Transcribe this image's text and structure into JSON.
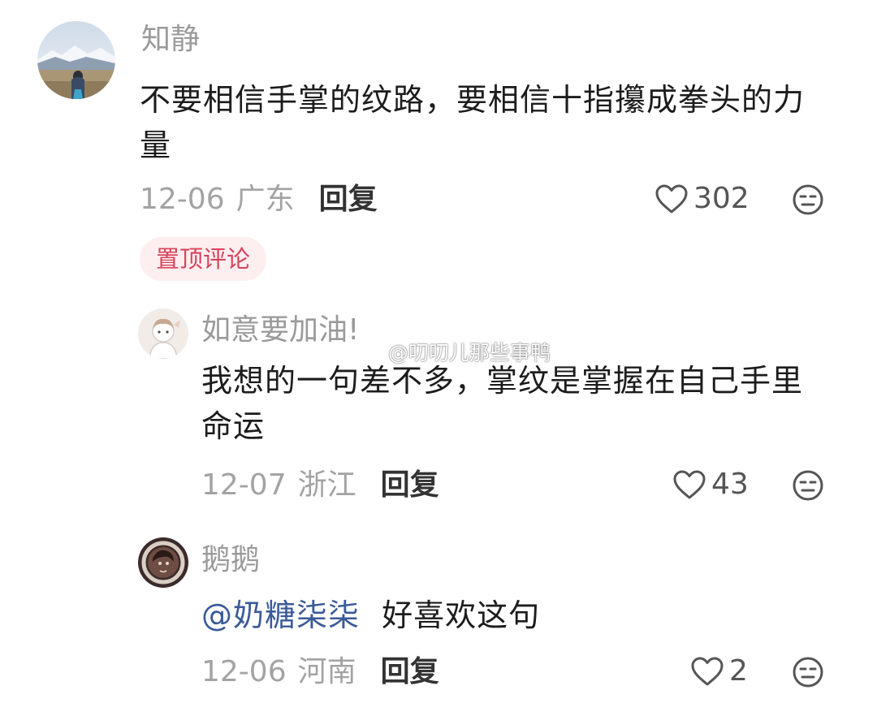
{
  "comments": [
    {
      "username": "知静",
      "content": "不要相信手掌的纹路，要相信十指攥成拳头的力量",
      "date": "12-06",
      "region": "广东",
      "reply": "回复",
      "likes": "302",
      "pinned_label": "置顶评论"
    },
    {
      "username": "如意要加油!",
      "content": "我想的一句差不多，掌纹是掌握在自己手里命运",
      "date": "12-07",
      "region": "浙江",
      "reply": "回复",
      "likes": "43"
    },
    {
      "username": "鹅鹅",
      "mention": "@奶糖柒柒",
      "content": "好喜欢这句",
      "date": "12-06",
      "region": "河南",
      "reply": "回复",
      "likes": "2"
    }
  ],
  "watermark": {
    "text": "@叨叨儿那些事鸭",
    "icon": "weibo-logo-icon"
  },
  "colors": {
    "username": "#9a9a9a",
    "mention": "#3a5a98",
    "pinned_text": "#d6455c",
    "pinned_bg": "#fdeef0"
  }
}
